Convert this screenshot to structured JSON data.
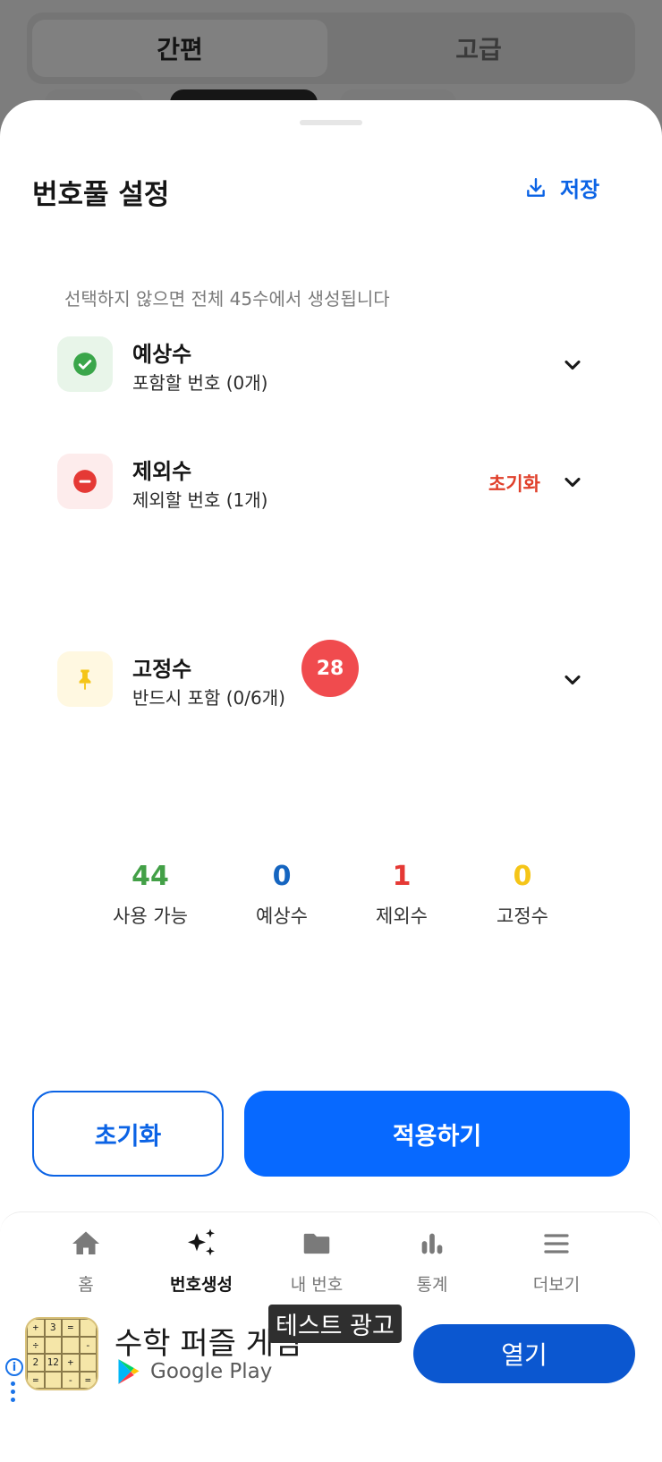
{
  "background": {
    "tabs": [
      {
        "label": "간편",
        "active": true
      },
      {
        "label": "고급",
        "active": false
      }
    ]
  },
  "sheet": {
    "title": "번호풀 설정",
    "save_label": "저장",
    "hint": "선택하지 않으면 전체 45수에서 생성됩니다",
    "rows": [
      {
        "title": "예상수",
        "subtitle": "포함할 번호 (0개)",
        "icon": "check-circle-icon",
        "color": "#3aa64a"
      },
      {
        "title": "제외수",
        "subtitle": "제외할 번호 (1개)",
        "icon": "minus-circle-icon",
        "color": "#e53935",
        "reset_label": "초기화"
      },
      {
        "title": "고정수",
        "subtitle": "반드시 포함 (0/6개)",
        "icon": "pin-icon",
        "color": "#f5c518"
      }
    ],
    "excluded_numbers": [
      "28"
    ],
    "stats": [
      {
        "value": "44",
        "label": "사용 가능",
        "color": "#43a047"
      },
      {
        "value": "0",
        "label": "예상수",
        "color": "#1565c0"
      },
      {
        "value": "1",
        "label": "제외수",
        "color": "#e53935"
      },
      {
        "value": "0",
        "label": "고정수",
        "color": "#f5c518"
      }
    ],
    "reset_button": "초기화",
    "apply_button": "적용하기"
  },
  "nav": {
    "items": [
      {
        "label": "홈",
        "icon": "home-icon",
        "active": false
      },
      {
        "label": "번호생성",
        "icon": "sparkle-icon",
        "active": true
      },
      {
        "label": "내 번호",
        "icon": "folder-icon",
        "active": false
      },
      {
        "label": "통계",
        "icon": "bar-chart-icon",
        "active": false
      },
      {
        "label": "더보기",
        "icon": "menu-icon",
        "active": false
      }
    ]
  },
  "ad": {
    "title": "수학 퍼즐 게임",
    "test_label": "테스트 광고",
    "store": "Google Play",
    "open_label": "열기",
    "puzzle_cells": [
      "+",
      "3",
      "=",
      "",
      "÷",
      "",
      "",
      "-",
      "2",
      "12",
      "+",
      "",
      "=",
      "",
      "-",
      "="
    ]
  }
}
